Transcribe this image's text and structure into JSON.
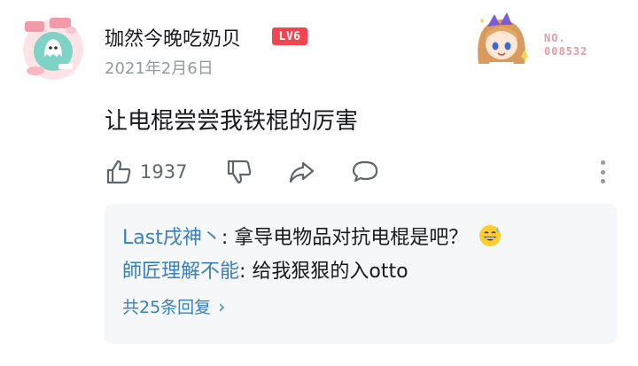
{
  "comment": {
    "username": "珈然今晚吃奶贝",
    "level": "LV6",
    "date": "2021年2月6日",
    "content": "让电棍尝尝我铁棍的厉害",
    "like_count": "1937",
    "fan_badge": {
      "line1": "NO.",
      "line2": "008532"
    }
  },
  "replies": [
    {
      "name": "Last戌神丶",
      "separator": ": ",
      "text": "拿导电物品对抗电棍是吧？",
      "emoji": "sweat-smile-emoji"
    },
    {
      "name": "師匠理解不能",
      "separator": ": ",
      "text": "给我狠狠的入otto"
    }
  ],
  "more_replies": {
    "label": "共25条回复",
    "chevron": "›"
  },
  "colors": {
    "level_badge": "#f3444f",
    "link": "#3a7fb9",
    "muted": "#9499a0",
    "reply_bg": "#f6f7f8"
  },
  "icons": [
    "thumbs-up-icon",
    "thumbs-down-icon",
    "share-icon",
    "comment-icon",
    "more-vertical-icon"
  ]
}
